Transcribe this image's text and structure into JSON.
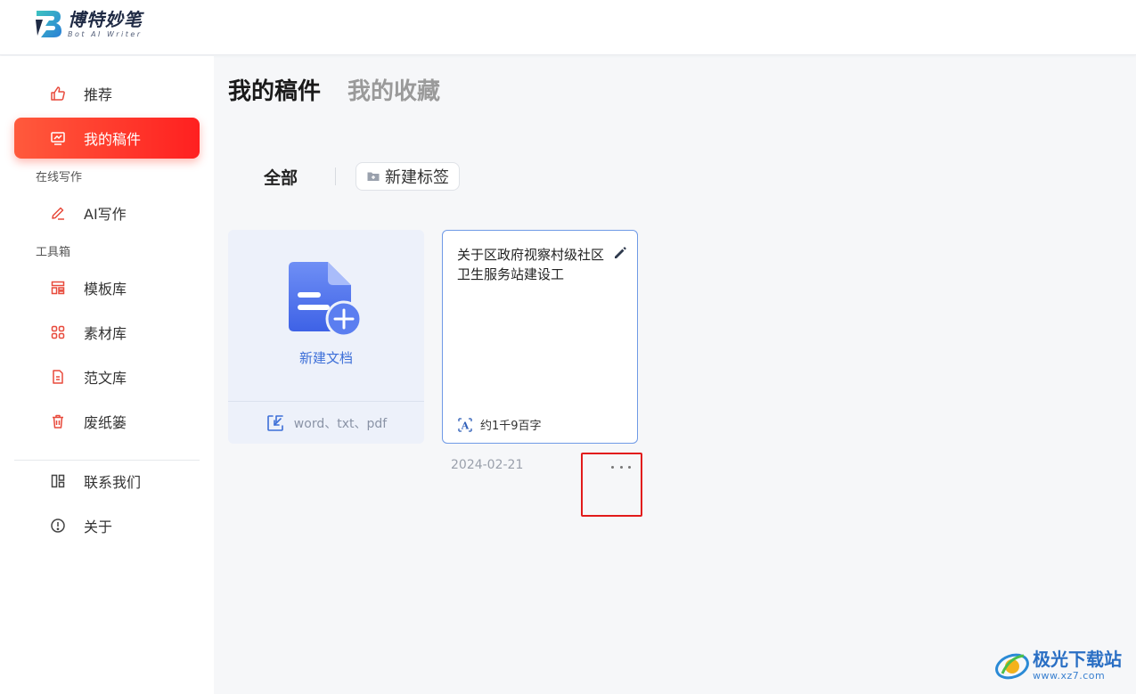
{
  "app": {
    "name_cn": "博特妙笔",
    "name_en": "Bot AI Writer"
  },
  "sidebar": {
    "items_top": [
      {
        "label": "推荐",
        "icon": "thumbs-up-icon"
      },
      {
        "label": "我的稿件",
        "icon": "chart-board-icon",
        "active": true
      }
    ],
    "section_online": "在线写作",
    "ai_write": {
      "label": "AI写作",
      "icon": "pen-icon"
    },
    "section_tools": "工具箱",
    "tools": [
      {
        "label": "模板库",
        "icon": "template-icon"
      },
      {
        "label": "素材库",
        "icon": "grid-icon"
      },
      {
        "label": "范文库",
        "icon": "document-icon"
      },
      {
        "label": "废纸篓",
        "icon": "trash-icon"
      }
    ],
    "bottom": [
      {
        "label": "联系我们",
        "icon": "layout-icon"
      },
      {
        "label": "关于",
        "icon": "info-icon"
      }
    ]
  },
  "main": {
    "tabs": [
      {
        "label": "我的稿件",
        "active": true
      },
      {
        "label": "我的收藏",
        "active": false
      }
    ],
    "filter_all": "全部",
    "new_tag_label": "新建标签",
    "new_doc": {
      "label": "新建文档",
      "import_label": "word、txt、pdf"
    },
    "documents": [
      {
        "title": "关于区政府视察村级社区卫生服务站建设工",
        "word_count": "约1千9百字",
        "date": "2024-02-21"
      }
    ]
  },
  "watermark": {
    "cn": "极光下载站",
    "url": "www.xz7.com"
  },
  "colors": {
    "accent": "#ff3a2a",
    "link_blue": "#3d6fd8",
    "highlight_red": "#e21b1b"
  }
}
